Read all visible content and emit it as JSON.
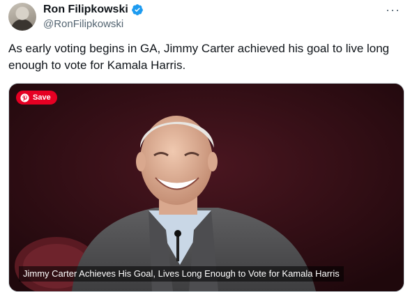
{
  "author": {
    "name": "Ron Filipkowski",
    "handle": "@RonFilipkowski",
    "verified": true,
    "verified_color": "#1d9bf0"
  },
  "menu": {
    "more_label": "···"
  },
  "tweet": {
    "text": "As early voting begins in GA, Jimmy Carter achieved his goal to live long enough to vote for Kamala Harris."
  },
  "media": {
    "save_label": "Save",
    "save_color": "#e60023",
    "caption": "Jimmy Carter Achieves His Goal, Lives Long Enough to Vote for Kamala Harris"
  }
}
